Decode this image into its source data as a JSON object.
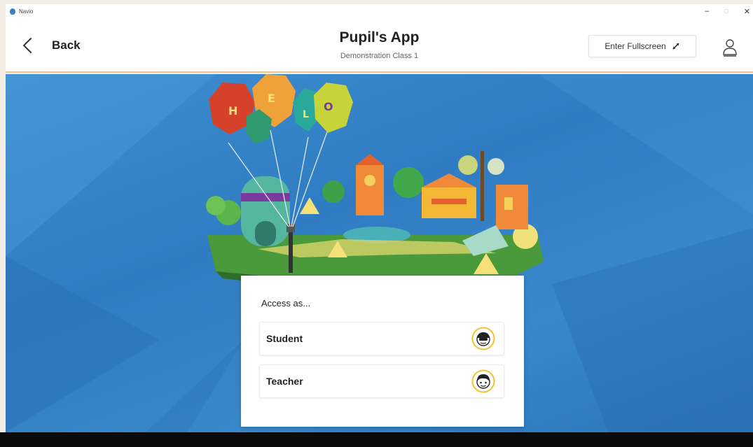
{
  "os_window": {
    "app_name": "Navio",
    "minimize_glyph": "–",
    "restore_glyph": "□",
    "close_glyph": "✕"
  },
  "header": {
    "back_label": "Back",
    "title": "Pupil's App",
    "subtitle": "Demonstration Class 1",
    "fullscreen_label": "Enter Fullscreen",
    "icons": {
      "back": "chevron-left-icon",
      "fullscreen": "expand-arrows-icon",
      "user": "user-icon"
    }
  },
  "illustration": {
    "balloon_letters": [
      "H",
      "E",
      "L",
      "O"
    ]
  },
  "access": {
    "heading": "Access as...",
    "options": [
      {
        "label": "Student",
        "icon": "student-avatar-icon"
      },
      {
        "label": "Teacher",
        "icon": "teacher-avatar-icon"
      }
    ]
  },
  "colors": {
    "background_blue": "#3182c6",
    "header_border": "#e7c98d",
    "avatar_ring": "#f2c12e",
    "card_bg": "#ffffff"
  }
}
